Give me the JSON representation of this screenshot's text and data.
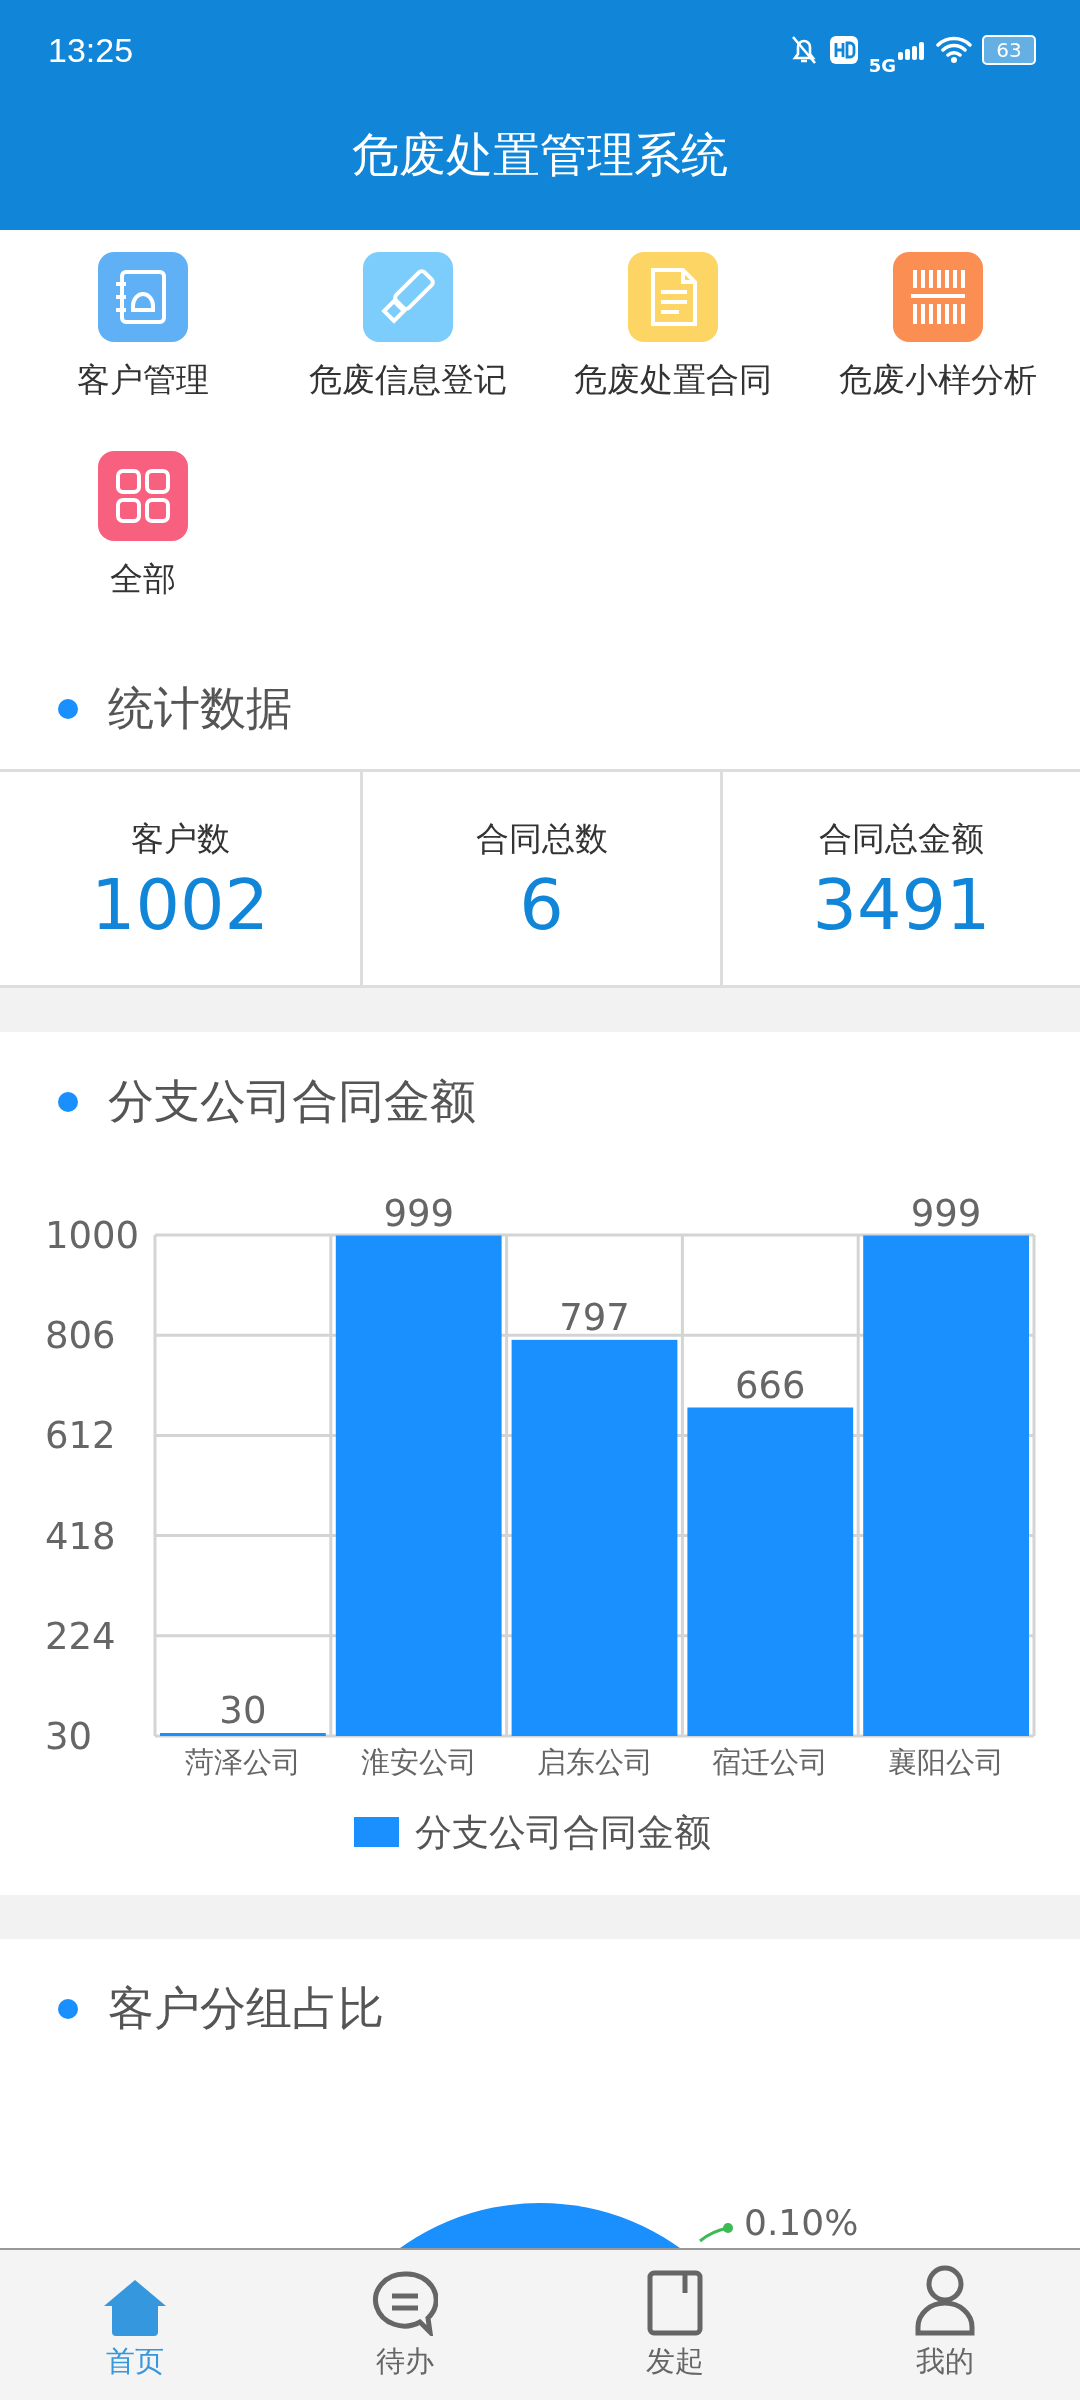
{
  "status_bar": {
    "time": "13:25",
    "network": "5G",
    "battery": "63"
  },
  "app_bar": {
    "title": "危废处置管理系统"
  },
  "shortcuts": [
    {
      "label": "客户管理",
      "kind": "contacts",
      "color": "#5fb0f5"
    },
    {
      "label": "危废信息登记",
      "kind": "stamp",
      "color": "#7dcdfc"
    },
    {
      "label": "危废处置合同",
      "kind": "document",
      "color": "#fdd564"
    },
    {
      "label": "危废小样分析",
      "kind": "barcode",
      "color": "#fb8e52"
    },
    {
      "label": "全部",
      "kind": "grid",
      "color": "#f7607e"
    }
  ],
  "stats": {
    "title": "统计数据",
    "items": [
      {
        "label": "客户数",
        "value": "1002"
      },
      {
        "label": "合同总数",
        "value": "6"
      },
      {
        "label": "合同总金额",
        "value": "3491"
      }
    ]
  },
  "branch_chart": {
    "title": "分支公司合同金额",
    "chart_data": {
      "type": "bar",
      "categories": [
        "菏泽公司",
        "淮安公司",
        "启东公司",
        "宿迁公司",
        "襄阳公司"
      ],
      "series": [
        {
          "name": "分支公司合同金额",
          "color": "#1a8ffe",
          "values": [
            30,
            999,
            797,
            666,
            999
          ]
        }
      ],
      "ylim": [
        30,
        1000
      ],
      "yticks": [
        30,
        224,
        418,
        612,
        806,
        1000
      ],
      "data_labels": true,
      "grid": true
    }
  },
  "group_chart": {
    "title": "客户分组占比",
    "visible_label": "0.10%"
  },
  "nav": [
    {
      "label": "首页",
      "kind": "home",
      "selected": true
    },
    {
      "label": "待办",
      "kind": "chat",
      "selected": false
    },
    {
      "label": "发起",
      "kind": "book",
      "selected": false
    },
    {
      "label": "我的",
      "kind": "user",
      "selected": false
    }
  ]
}
